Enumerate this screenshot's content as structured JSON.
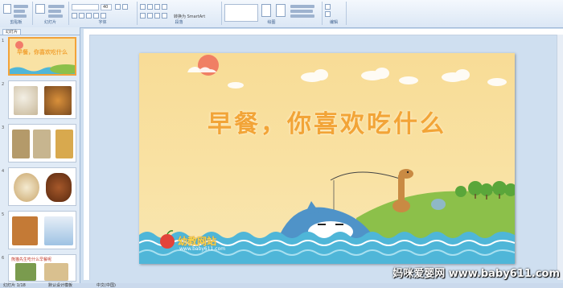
{
  "ribbon": {
    "groups": [
      "剪贴板",
      "幻灯片",
      "字体",
      "段落",
      "绘图",
      "编辑"
    ],
    "font_size_value": "40",
    "convert_label": "转换为 SmartArt"
  },
  "slide_panel": {
    "tab_label": "幻灯片",
    "thumbnails": [
      {
        "num": "1",
        "caption": "早餐，你喜欢吃什么"
      },
      {
        "num": "2",
        "caption": ""
      },
      {
        "num": "3",
        "caption": ""
      },
      {
        "num": "4",
        "caption": ""
      },
      {
        "num": "5",
        "caption": ""
      },
      {
        "num": "6",
        "caption": "熊猫先生吃什么早餐呢"
      }
    ]
  },
  "slide": {
    "title": "早餐，你喜欢吃什么",
    "logo_text": "幼教网站",
    "logo_url": "www.baby611.com"
  },
  "status_bar": {
    "slide_info": "幻灯片 1/18",
    "theme": "默认设计模板",
    "language": "中文(中国)"
  },
  "watermark": "妈咪爱婴网 www.baby611.com",
  "colors": {
    "title": "#f2a437",
    "slide_bg": "#f9e2a4",
    "water": "#4fb6d8",
    "grass": "#8cc04a"
  }
}
